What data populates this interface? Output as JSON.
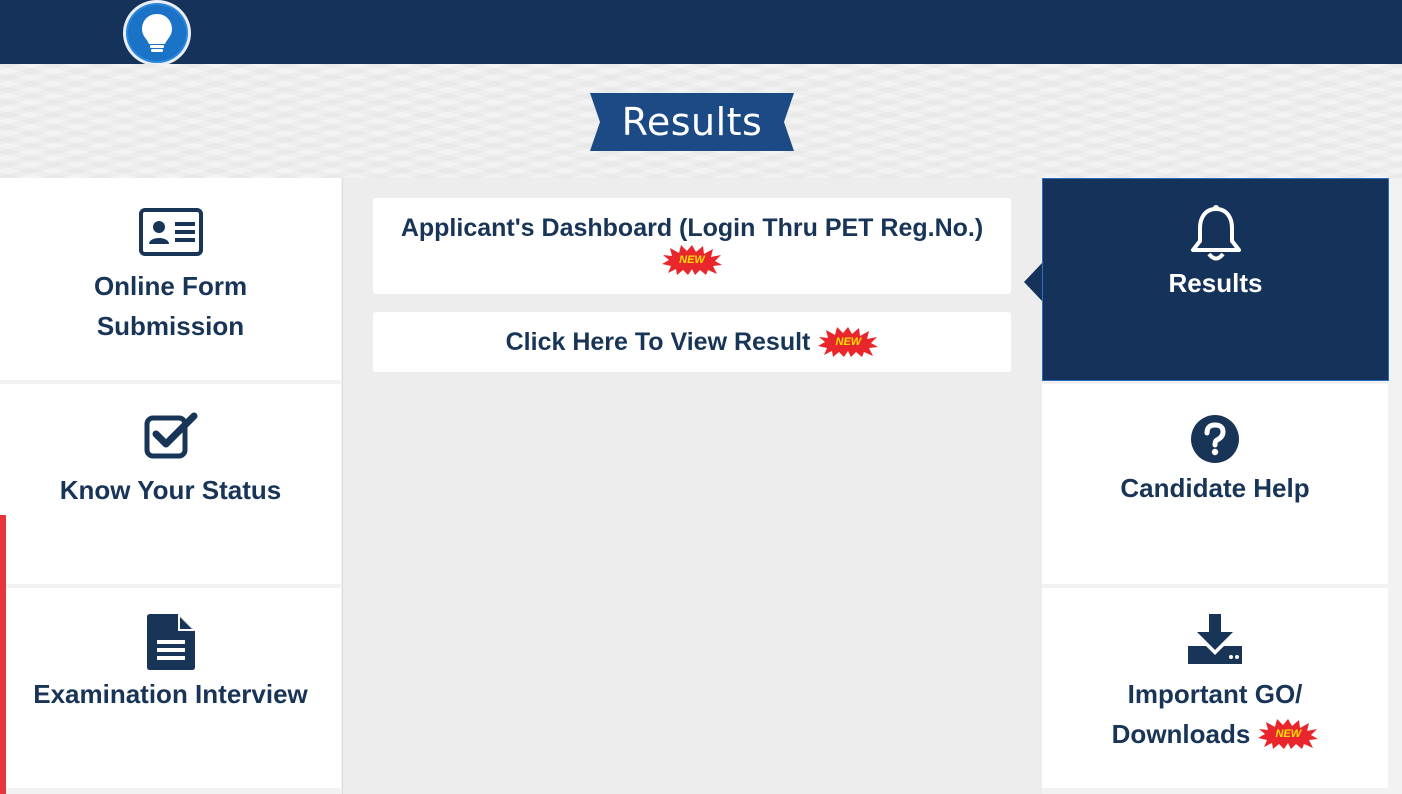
{
  "header": {
    "logo_icon": "lightbulb-icon",
    "colors": {
      "navy": "#14325a",
      "accent_blue": "#1b73c7",
      "badge_red": "#e8262b",
      "badge_yellow": "#ffe000"
    }
  },
  "banner": {
    "title": "Results"
  },
  "left_menu": [
    {
      "label_line1": "Online Form",
      "label_line2": "Submission",
      "icon": "id-card-icon"
    },
    {
      "label": "Know Your Status",
      "icon": "checkbox-icon"
    },
    {
      "label": "Examination Interview",
      "icon": "document-icon"
    }
  ],
  "content": {
    "links": [
      {
        "label": "Applicant's Dashboard (Login Thru PET Reg.No.)",
        "badge": "NEW"
      },
      {
        "label": "Click Here To View Result",
        "badge": "NEW"
      }
    ]
  },
  "right_menu": [
    {
      "label": "Results",
      "icon": "bell-icon",
      "active": true
    },
    {
      "label": "Candidate Help",
      "icon": "question-circle-icon"
    },
    {
      "label_line1": "Important GO/",
      "label_line2": "Downloads",
      "icon": "download-icon",
      "badge": "NEW"
    }
  ]
}
